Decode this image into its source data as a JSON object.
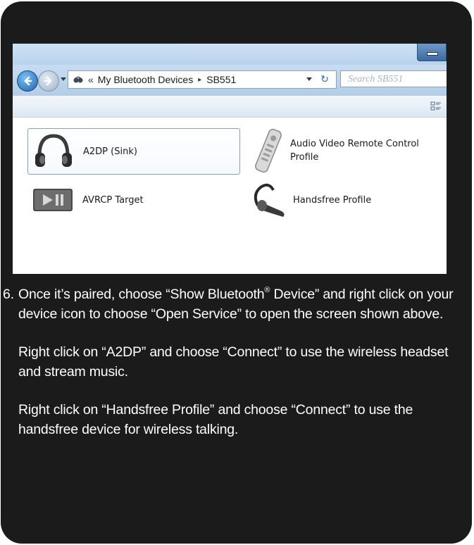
{
  "window": {
    "address_segments": [
      "My Bluetooth Devices",
      "SB551"
    ],
    "address_chevron": "«",
    "address_separator": "▸",
    "search_placeholder": "Search SB551",
    "icons": [
      "back-arrow-icon",
      "forward-arrow-icon",
      "bluetooth-folder-icon",
      "refresh-icon",
      "minimize-icon",
      "change-view-icon"
    ],
    "services": [
      {
        "label": "A2DP (Sink)",
        "icon": "headphones-icon",
        "selected": true
      },
      {
        "label": "Audio Video Remote Control Profile",
        "icon": "remote-control-icon",
        "selected": false
      },
      {
        "label": "AVRCP Target",
        "icon": "play-pause-button-icon",
        "selected": false
      },
      {
        "label": "Handsfree Profile",
        "icon": "bluetooth-headset-icon",
        "selected": false
      }
    ]
  },
  "instructions": {
    "step_number": "6.",
    "step_text_before_sup": "Once it’s paired, choose “Show Bluetooth",
    "step_superscript": "®",
    "step_text_after_sup": " Device” and right click on your device icon to choose “Open Service” to open the screen shown above.",
    "para_a2dp": "Right click on “A2DP” and choose “Connect”  to use the wireless headset and stream music.",
    "para_handsfree": "Right click on “Handsfree Profile” and choose “Connect” to use the handsfree device for wireless talking."
  },
  "colors": {
    "panel_background": "#1b1b1b",
    "instruction_text": "#ffffff",
    "window_chrome": "#c8dcf1",
    "selection_border": "#7da2ce"
  }
}
